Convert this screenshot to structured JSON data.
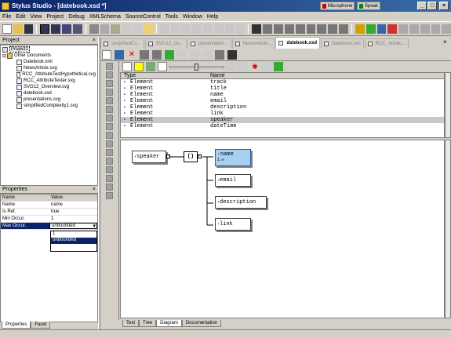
{
  "window": {
    "title": "Stylus Studio - [datebook.xsd *]",
    "mic_label": "Microphone",
    "speak_label": "Speak"
  },
  "menu": [
    "File",
    "Edit",
    "View",
    "Project",
    "Debug",
    "XMLSchema",
    "SourceControl",
    "Tools",
    "Window",
    "Help"
  ],
  "project_panel": {
    "title": "Project",
    "root": "Project1",
    "folder": "Other Documents",
    "files": [
      "Datebook.xml",
      "NewsArticle.svg",
      "RCC_AttributeTestHypothetical.svg",
      "RCC_AttributeTester.svg",
      "SVG12_Overview.svg",
      "datebook.xsd",
      "presentations.svg",
      "simplifiedComplexity1.svg"
    ]
  },
  "properties_panel": {
    "title": "Properties",
    "headers": [
      "Name",
      "Value"
    ],
    "rows": [
      {
        "name": "Name",
        "value": "name"
      },
      {
        "name": "Is Ref.",
        "value": "true"
      },
      {
        "name": "Min Occur.",
        "value": "1"
      },
      {
        "name": "Max Occur.",
        "value": "unbounded"
      }
    ],
    "dropdown_options": [
      "1",
      "unbounded"
    ],
    "tabs": [
      "Properties",
      "Facet"
    ]
  },
  "doc_tabs": [
    "simplifiedCo...",
    "SVG12_Ov...",
    "presentation...",
    "NewsArticle...",
    "datebook.xsd",
    "Datebook.xml",
    "RCC_Attribu..."
  ],
  "active_doc_tab": "datebook.xsd",
  "grid": {
    "headers": [
      "Type",
      "Name"
    ],
    "rows": [
      {
        "type": "Element",
        "name": "track"
      },
      {
        "type": "Element",
        "name": "title"
      },
      {
        "type": "Element",
        "name": "name"
      },
      {
        "type": "Element",
        "name": "email"
      },
      {
        "type": "Element",
        "name": "description"
      },
      {
        "type": "Element",
        "name": "link"
      },
      {
        "type": "Element",
        "name": "speaker"
      },
      {
        "type": "Element",
        "name": "dateTime"
      }
    ],
    "selected_index": 6
  },
  "diagram": {
    "root": "speaker",
    "compositor": "()",
    "children": [
      {
        "label": "name",
        "occurs": "1..∞"
      },
      {
        "label": "email"
      },
      {
        "label": "description"
      },
      {
        "label": "link"
      }
    ]
  },
  "editor_tabs": [
    "Text",
    "Tree",
    "Diagram",
    "Documentation"
  ],
  "active_editor_tab": "Diagram"
}
